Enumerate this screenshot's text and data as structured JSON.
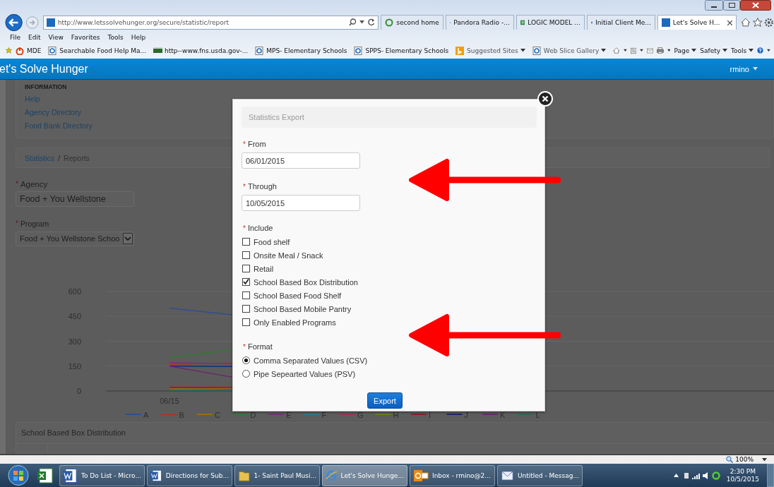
{
  "browser": {
    "url": "http://www.letssolvehunger.org/secure/statistic/report",
    "tabs": [
      {
        "label": "second home",
        "selected": false
      },
      {
        "label": "Pandora Radio -...",
        "selected": false
      },
      {
        "label": "LOGIC MODEL ...",
        "selected": false
      },
      {
        "label": "Initial Client Me...",
        "selected": false
      },
      {
        "label": "Let's Solve H...",
        "selected": true
      }
    ],
    "menu": [
      "File",
      "Edit",
      "View",
      "Favorites",
      "Tools",
      "Help"
    ],
    "favorites": [
      "MDE",
      "Searchable Food Help Ma...",
      "http--www.fns.usda.gov-...",
      "MPS- Elementary Schools",
      "SPPS- Elementary Schools",
      "Suggested Sites",
      "Web Slice Gallery"
    ],
    "commands": [
      "Page",
      "Safety",
      "Tools"
    ]
  },
  "app": {
    "title": "et's Solve Hunger",
    "user": "rmino"
  },
  "sidebar": {
    "heading": "INFORMATION",
    "links": [
      "Help",
      "Agency Directory",
      "Food Bank Directory"
    ]
  },
  "breadcrumb": [
    {
      "label": "Statistics",
      "link": true
    },
    {
      "label": "Reports",
      "link": false
    }
  ],
  "breadcrumb_separator": "/",
  "filters": [
    {
      "asterisk": "*",
      "label": "Agency",
      "value": "Food + You Wellstone",
      "kind": "text"
    },
    {
      "asterisk": "*",
      "label": "Program",
      "value": "Food + You Wellstone Schoo",
      "kind": "select"
    }
  ],
  "chart": {
    "y_ticks": [
      "600",
      "450",
      "300",
      "150",
      "0"
    ],
    "x_labels": [
      "06/15"
    ],
    "legend": [
      {
        "name": "A",
        "color": "#2f4f8f"
      },
      {
        "name": "B",
        "color": "#a33a2a"
      },
      {
        "name": "C",
        "color": "#a06a10"
      },
      {
        "name": "D",
        "color": "#2f7a2f"
      },
      {
        "name": "E",
        "color": "#7a2f7a"
      },
      {
        "name": "F",
        "color": "#2a7a8a"
      },
      {
        "name": "G",
        "color": "#a03050"
      },
      {
        "name": "H",
        "color": "#6a7a20"
      },
      {
        "name": "I",
        "color": "#8a2020"
      },
      {
        "name": "J",
        "color": "#1a2a6a"
      },
      {
        "name": "K",
        "color": "#6a2a6a"
      },
      {
        "name": "L",
        "color": "#2a6a5a"
      }
    ]
  },
  "table_panel": {
    "title": "School Based Box Distribution"
  },
  "modal": {
    "title": "Statistics Export",
    "dates": [
      {
        "asterisk": "*",
        "label": "From",
        "value": "06/01/2015"
      },
      {
        "asterisk": "*",
        "label": "Through",
        "value": "10/05/2015"
      }
    ],
    "include": {
      "asterisk": "*",
      "label": "Include",
      "options": [
        {
          "label": "Food shelf",
          "checked": false
        },
        {
          "label": "Onsite Meal / Snack",
          "checked": false
        },
        {
          "label": "Retail",
          "checked": false
        },
        {
          "label": "School Based Box Distribution",
          "checked": true
        },
        {
          "label": "School Based Food Shelf",
          "checked": false
        },
        {
          "label": "School Based Mobile Pantry",
          "checked": false
        },
        {
          "label": "Only Enabled Programs",
          "checked": false
        }
      ]
    },
    "format": {
      "asterisk": "*",
      "label": "Format",
      "options": [
        {
          "label": "Comma Separated Values (CSV)",
          "selected": true
        },
        {
          "label": "Pipe Sepearted Values (PSV)",
          "selected": false
        }
      ]
    },
    "button": "Export"
  },
  "status_bar": {
    "zoom": "100%"
  },
  "taskbar": {
    "items": [
      {
        "label": "To Do List - Micro...",
        "kind": "word",
        "selected": false
      },
      {
        "label": "Directions for Sub...",
        "kind": "word",
        "selected": false
      },
      {
        "label": "1- Saint Paul Musi...",
        "kind": "folder",
        "selected": false
      },
      {
        "label": "Let's Solve Hunge...",
        "kind": "browser",
        "selected": true
      },
      {
        "label": "Inbox - rmino@2...",
        "kind": "outlook",
        "selected": false
      },
      {
        "label": "Untitled - Messag...",
        "kind": "message",
        "selected": false
      }
    ],
    "time": "2:30 PM",
    "date": "10/5/2015"
  }
}
